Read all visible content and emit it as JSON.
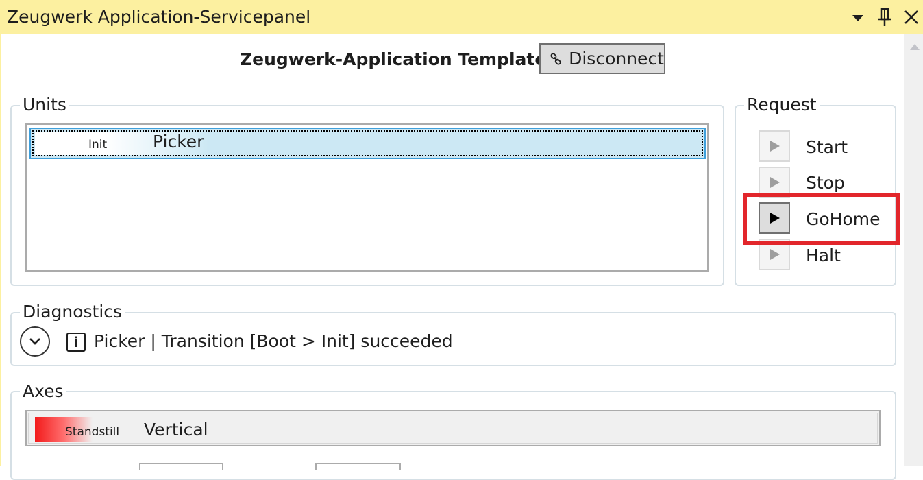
{
  "window": {
    "title": "Zeugwerk Application-Servicepanel",
    "accent_color": "#fcf0a0"
  },
  "titlebar_icons": {
    "menu": "dropdown-arrow-icon",
    "pin": "pin-icon",
    "close": "close-icon"
  },
  "header": {
    "app_name": "Zeugwerk-Application Template",
    "disconnect_label": "Disconnect",
    "disconnect_icon": "link-icon"
  },
  "units": {
    "legend": "Units",
    "items": [
      {
        "state": "Init",
        "name": "Picker",
        "selected": true
      }
    ]
  },
  "request": {
    "legend": "Request",
    "buttons": [
      {
        "label": "Start",
        "enabled": false
      },
      {
        "label": "Stop",
        "enabled": false
      },
      {
        "label": "GoHome",
        "enabled": true,
        "highlighted": true
      },
      {
        "label": "Halt",
        "enabled": false
      }
    ],
    "highlight_color": "#e2262b"
  },
  "diagnostics": {
    "legend": "Diagnostics",
    "expand_icon": "chevron-down-icon",
    "message_icon": "info-icon",
    "info_glyph": "i",
    "message": "Picker | Transition [Boot > Init] succeeded"
  },
  "axes": {
    "legend": "Axes",
    "items": [
      {
        "state": "Standstill",
        "name": "Vertical",
        "state_color": "#f21a1a"
      }
    ]
  }
}
